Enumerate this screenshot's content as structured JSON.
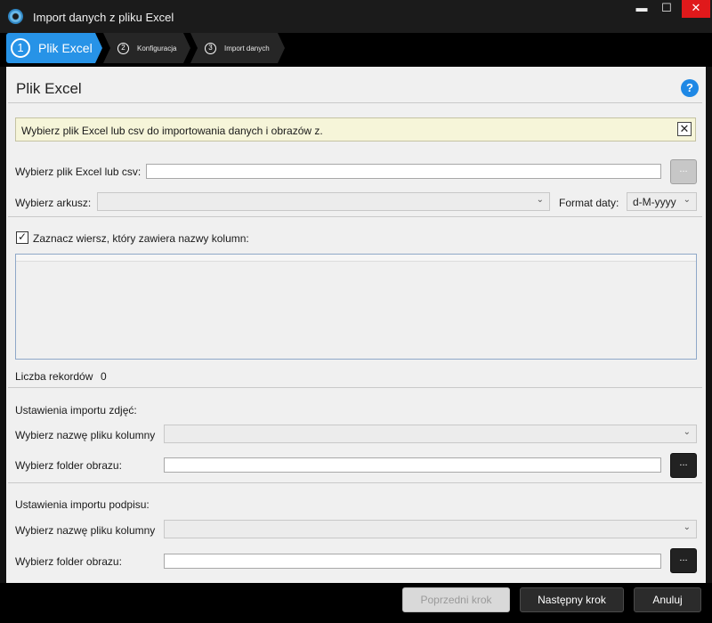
{
  "window": {
    "title": "Import danych z pliku Excel",
    "minimize_glyph": "▬",
    "maximize_glyph": "☐",
    "close_glyph": "✕"
  },
  "steps": [
    {
      "number": "1",
      "label": "Plik Excel"
    },
    {
      "number": "2",
      "label": "Konfiguracja"
    },
    {
      "number": "3",
      "label": "Import danych"
    }
  ],
  "page": {
    "title": "Plik Excel",
    "help_glyph": "?"
  },
  "banner": {
    "text": "Wybierz plik Excel lub csv do importowania danych i obrazów z.",
    "close_glyph": "✕"
  },
  "file": {
    "label": "Wybierz plik Excel lub csv:",
    "value": "",
    "browse_label": "..."
  },
  "sheet": {
    "label": "Wybierz arkusz:",
    "value": "",
    "date_format_label": "Format daty:",
    "date_format_value": "d-M-yyyy"
  },
  "header_row": {
    "checked": true,
    "check_glyph": "✓",
    "label": "Zaznacz wiersz, który zawiera nazwy kolumn:"
  },
  "records": {
    "label": "Liczba rekordów",
    "count": "0"
  },
  "photo_import": {
    "section_title": "Ustawienia importu zdjęć:",
    "column_label": "Wybierz nazwę pliku kolumny",
    "column_value": "",
    "folder_label": "Wybierz folder obrazu:",
    "folder_value": "",
    "browse_label": "..."
  },
  "signature_import": {
    "section_title": "Ustawienia importu podpisu:",
    "column_label": "Wybierz nazwę pliku kolumny",
    "column_value": "",
    "folder_label": "Wybierz folder obrazu:",
    "folder_value": "",
    "browse_label": "..."
  },
  "footer": {
    "prev_label": "Poprzedni krok",
    "next_label": "Następny krok",
    "cancel_label": "Anuluj"
  },
  "icons": {
    "app": "app-logo-icon",
    "dropdown": "chevron-down-icon"
  },
  "colors": {
    "accent": "#2793e7",
    "banner_bg": "#f6f5d9",
    "close_red": "#e0191b"
  }
}
